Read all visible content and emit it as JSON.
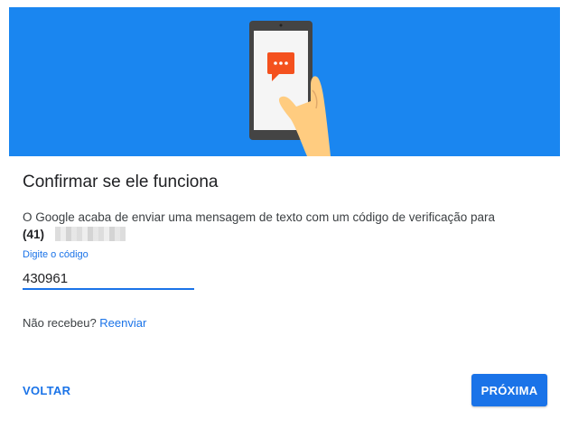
{
  "hero": {
    "illustration": "phone-receiving-message",
    "background_color": "#1a86f0",
    "bubble_color": "#f4511e"
  },
  "heading": "Confirmar se ele funciona",
  "description": "O Google acaba de enviar uma mensagem de texto com um código de verificação para",
  "phone": {
    "prefix": "(41)"
  },
  "code_field": {
    "label": "Digite o código",
    "value": "430961"
  },
  "resend": {
    "prompt": "Não recebeu?",
    "link_label": "Reenviar"
  },
  "actions": {
    "back_label": "VOLTAR",
    "next_label": "PRÓXIMA"
  },
  "colors": {
    "accent": "#1a73e8",
    "text": "#202124"
  }
}
